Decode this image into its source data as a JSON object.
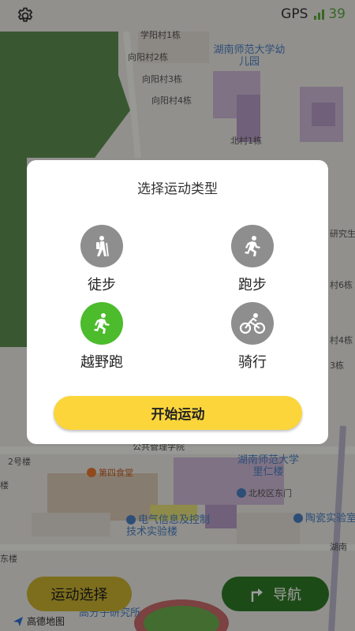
{
  "map": {
    "labels": {
      "xiangyang2": "向阳村2栋",
      "xiangyang3": "向阳村3栋",
      "xiangyang4": "向阳村4栋",
      "beicun1": "北村1栋",
      "kindergarten": "湖南师范大学幼儿园",
      "building2": "2号楼",
      "canteen4": "第四食堂",
      "public_admin": "公共管理学院",
      "renju": "湖南师范大学里仁楼",
      "north_east_gate": "北校区东门",
      "electrical": "电气信息及控制技术实验楼",
      "ceramics": "陶瓷实验室",
      "polymer": "高分子研究所",
      "dongdong": "东楼",
      "building3": "3栋",
      "building4": "村4栋",
      "building6": "村6栋",
      "renlou": "里仁楼",
      "research": "研究生",
      "hunan": "湖南"
    },
    "colors": {
      "park": "#5c8f52",
      "road": "#f4f3ef",
      "block": "#d9c9b4",
      "purple": "#cdb8d6"
    }
  },
  "topbar": {
    "gear_icon": "gear-icon",
    "gps_label": "GPS",
    "gps_value": "39",
    "accent": "#5aa83c"
  },
  "dialog": {
    "title": "选择运动类型",
    "options": [
      {
        "label": "徒步",
        "icon": "hiking-icon",
        "active": false
      },
      {
        "label": "跑步",
        "icon": "running-icon",
        "active": false
      },
      {
        "label": "越野跑",
        "icon": "trail-running-icon",
        "active": true
      },
      {
        "label": "骑行",
        "icon": "cycling-icon",
        "active": false
      }
    ],
    "start_label": "开始运动",
    "colors": {
      "active": "#4cbb2c",
      "inactive": "#8e8e8e",
      "start": "#fbd53a"
    }
  },
  "bottom": {
    "sport_select_label": "运动选择",
    "nav_label": "导航",
    "nav_icon": "turn-right-icon",
    "logo_text": "高德地图"
  }
}
